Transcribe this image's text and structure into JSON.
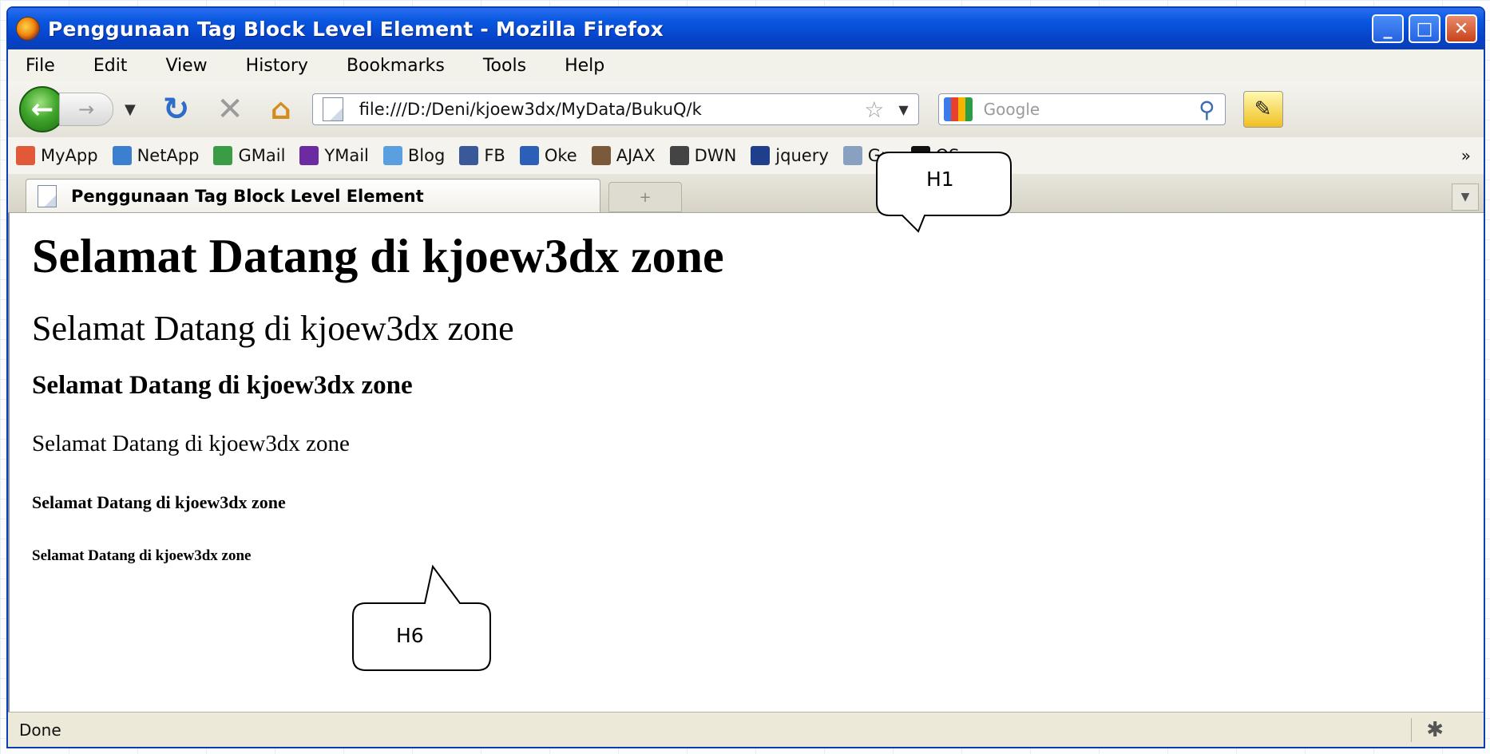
{
  "window": {
    "title": "Penggunaan Tag Block Level Element - Mozilla Firefox",
    "minimize": "_",
    "maximize": "□",
    "close": "✕"
  },
  "menu": [
    "File",
    "Edit",
    "View",
    "History",
    "Bookmarks",
    "Tools",
    "Help"
  ],
  "nav": {
    "back_icon": "←",
    "forward_icon": "→",
    "url": "file:///D:/Deni/kjoew3dx/MyData/BukuQ/k",
    "search_placeholder": "Google"
  },
  "bookmarks": [
    {
      "label": "MyApp",
      "color": "#e2593a"
    },
    {
      "label": "NetApp",
      "color": "#3a7fd0"
    },
    {
      "label": "GMail",
      "color": "#3a9d46"
    },
    {
      "label": "YMail",
      "color": "#6a2ca0"
    },
    {
      "label": "Blog",
      "color": "#5aa0e0"
    },
    {
      "label": "FB",
      "color": "#3b5998"
    },
    {
      "label": "Oke",
      "color": "#2b5fb8"
    },
    {
      "label": "AJAX",
      "color": "#7a5a3a"
    },
    {
      "label": "DWN",
      "color": "#444444"
    },
    {
      "label": "jquery",
      "color": "#1f3f8a"
    },
    {
      "label": "Grs",
      "color": "#8aa0c0"
    },
    {
      "label": "OS",
      "color": "#111111"
    }
  ],
  "bookmarks_more": "»",
  "tab": {
    "label": "Penggunaan Tag Block Level Element",
    "new_tab": "+"
  },
  "page": {
    "h1": "Selamat Datang di kjoew3dx zone",
    "h2": "Selamat Datang di kjoew3dx zone",
    "h3": "Selamat Datang di kjoew3dx zone",
    "h4": "Selamat Datang di kjoew3dx zone",
    "h5": "Selamat Datang di kjoew3dx zone",
    "h6": "Selamat Datang di kjoew3dx zone"
  },
  "status": {
    "text": "Done"
  },
  "callouts": {
    "top": "H1",
    "bottom": "H6"
  }
}
